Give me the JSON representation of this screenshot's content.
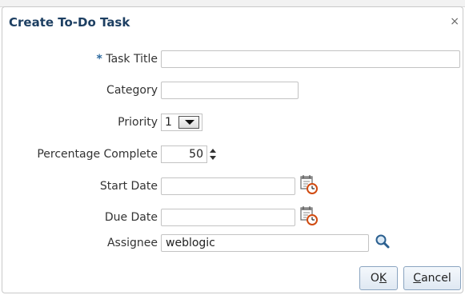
{
  "dialog": {
    "title": "Create To-Do Task",
    "close_glyph": "×"
  },
  "form": {
    "task_title": {
      "required_mark": "*",
      "label": "Task Title",
      "value": ""
    },
    "category": {
      "label": "Category",
      "value": ""
    },
    "priority": {
      "label": "Priority",
      "selected": "1"
    },
    "percentage_complete": {
      "label": "Percentage Complete",
      "value": "50"
    },
    "start_date": {
      "label": "Start Date",
      "value": "",
      "icon": "calendar-icon"
    },
    "due_date": {
      "label": "Due Date",
      "value": "",
      "icon": "calendar-icon"
    },
    "assignee": {
      "label": "Assignee",
      "value": "weblogic",
      "icon": "search-icon"
    }
  },
  "buttons": {
    "ok": {
      "pre": "O",
      "mnemonic": "K",
      "post": ""
    },
    "cancel": {
      "pre": "",
      "mnemonic": "C",
      "post": "ancel"
    }
  },
  "colors": {
    "title": "#1d3f62",
    "required": "#2d6a9f",
    "button_border": "#8aa4c0"
  }
}
